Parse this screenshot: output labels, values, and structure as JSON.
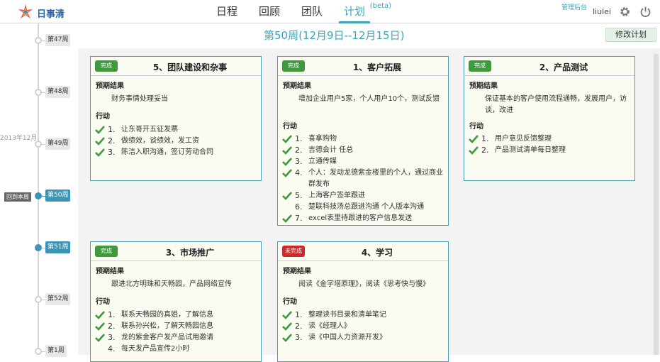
{
  "app": {
    "logo_text": "日事清"
  },
  "nav": {
    "tabs": [
      {
        "label": "日程"
      },
      {
        "label": "回顾"
      },
      {
        "label": "团队"
      },
      {
        "label": "计划",
        "sup": "(beta)"
      }
    ]
  },
  "header": {
    "admin_link": "管理后台",
    "username": "liulei"
  },
  "week": {
    "title": "第50周(12月9日--12月15日)",
    "edit_button": "修改计划"
  },
  "timeline": {
    "month_label": "2013年12月",
    "back_label": "回到本周",
    "weeks": [
      {
        "label": "第47周"
      },
      {
        "label": "第48周"
      },
      {
        "label": "第49周"
      },
      {
        "label": "第50周"
      },
      {
        "label": "第51周"
      },
      {
        "label": "第52周"
      },
      {
        "label": "第1周"
      }
    ]
  },
  "labels": {
    "result": "预期结果",
    "actions": "行动"
  },
  "cards": [
    {
      "status": "完成",
      "title": "5、团队建设和杂事",
      "result": "财务事情处理妥当",
      "actions": [
        {
          "n": "1.",
          "text": "让东哥开五征发票",
          "done": true
        },
        {
          "n": "2.",
          "text": "做绩效，谈绩效，发工资",
          "done": true
        },
        {
          "n": "3.",
          "text": "陈洁入职沟通，签订劳动合同",
          "done": true
        }
      ]
    },
    {
      "status": "完成",
      "title": "1、客户拓展",
      "result": "增加企业用户5家，个人用户10个，测试反馈",
      "actions": [
        {
          "n": "1.",
          "text": "喜拿购物",
          "done": true
        },
        {
          "n": "2.",
          "text": "吉德会计 任总",
          "done": true
        },
        {
          "n": "3.",
          "text": "立通传媒",
          "done": true
        },
        {
          "n": "4.",
          "text": "个人：发动龙德紫金楼里的个人，通过商业群发布",
          "done": true
        },
        {
          "n": "5.",
          "text": "上海客户签单跟进",
          "done": true
        },
        {
          "n": "6.",
          "text": "楚联科技汤总跟进沟通 个人版本沟通",
          "done": false
        },
        {
          "n": "7.",
          "text": "excel表里待跟进的客户信息发送",
          "done": true
        }
      ]
    },
    {
      "status": "完成",
      "title": "2、产品测试",
      "result": "保证基本的客户使用流程通畅，发展用户，访谈，改进",
      "actions": [
        {
          "n": "1.",
          "text": "用户意见反馈整理",
          "done": true
        },
        {
          "n": "2.",
          "text": "产品测试清单每日整理",
          "done": true
        }
      ]
    },
    {
      "status": "完成",
      "title": "3、市场推广",
      "result": "跟进北方明珠和天畅园，产品网络宣传",
      "actions": [
        {
          "n": "1.",
          "text": "联系天畅园的真姐，了解信息",
          "done": true
        },
        {
          "n": "2.",
          "text": "联系孙兴松，了解天畅园信息",
          "done": true
        },
        {
          "n": "3.",
          "text": "龙的紫金客户发产品试用邀请",
          "done": true
        },
        {
          "n": "4.",
          "text": "每天发产品宣传2小时",
          "done": false
        }
      ]
    },
    {
      "status": "未完成",
      "title": "4、学习",
      "result": "阅读《金字塔原理》，阅读《思考快与慢》",
      "actions": [
        {
          "n": "1.",
          "text": "整理读书目录和清单笔记",
          "done": true
        },
        {
          "n": "2.",
          "text": "读《经理人》",
          "done": true
        },
        {
          "n": "3.",
          "text": "读《中国人力资源开发》",
          "done": true
        }
      ]
    }
  ],
  "colors": {
    "accent": "#3aa6b8",
    "done_green": "#3f9a3f",
    "undone_red": "#cc2b2b",
    "card_bg": "#fafbf1"
  }
}
